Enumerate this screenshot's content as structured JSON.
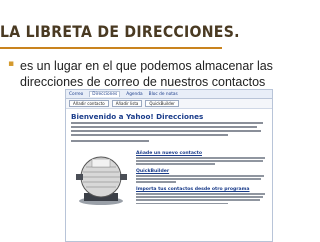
{
  "slide": {
    "title": "LA LIBRETA DE DIRECCIONES.",
    "bullet": "es un lugar en el que podemos almacenar las direcciones de correo de nuestros contactos"
  },
  "screenshot": {
    "tabs": [
      "Correo",
      "Direcciones",
      "Agenda",
      "Bloc de notas"
    ],
    "toolbar": [
      "Añadir contacto",
      "Añadir lista",
      "QuickBuilder"
    ],
    "welcome": "Bienvenido a Yahoo! Direcciones",
    "features": [
      {
        "title": "Añade un nuevo contacto"
      },
      {
        "title": "QuickBuilder"
      },
      {
        "title": "Importa tus contactos desde otro programa"
      }
    ]
  },
  "colors": {
    "title": "#4a3a22",
    "accent": "#c9831e",
    "link": "#1a3c8a"
  }
}
